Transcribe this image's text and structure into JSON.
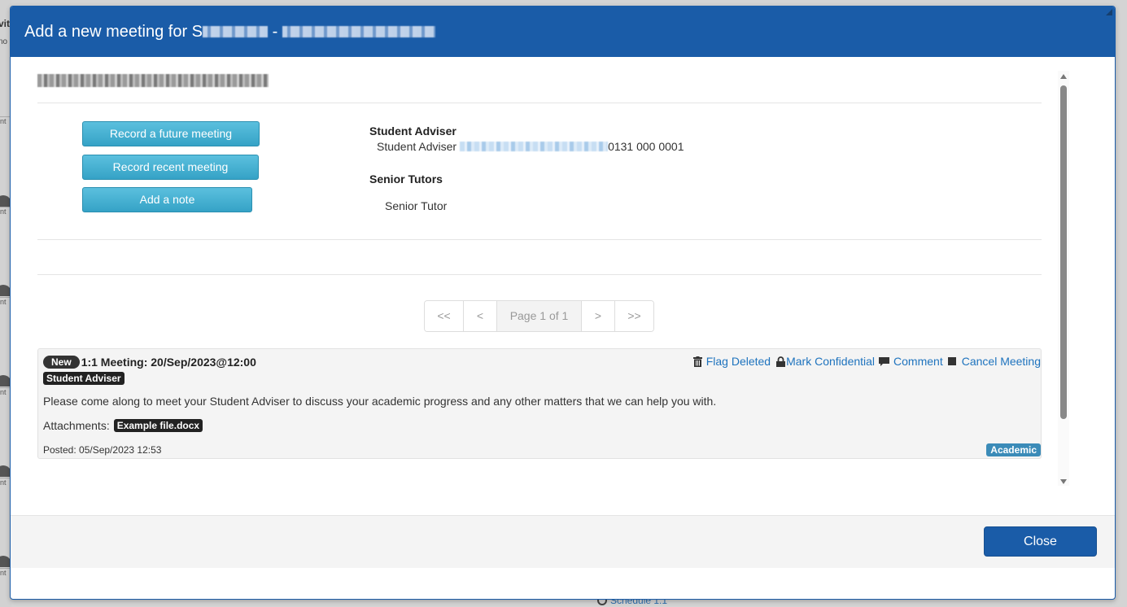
{
  "background": {
    "left_fragments": [
      "vit",
      "no"
    ],
    "row_labels": [
      "nt",
      "nt",
      "nt",
      "nt",
      "nt",
      "nt"
    ],
    "schedule_link": "Schedule 1:1"
  },
  "modal": {
    "title_prefix": "Add a new meeting for S",
    "title_separator": " - ",
    "student_heading_redacted": true,
    "buttons": {
      "record_future": "Record a future meeting",
      "record_recent": "Record recent meeting",
      "add_note": "Add a note"
    },
    "student_adviser": {
      "heading": "Student Adviser",
      "name": "Student Adviser",
      "phone": "0131 000 0001"
    },
    "senior_tutors": {
      "heading": "Senior Tutors",
      "name": "Senior Tutor"
    },
    "pagination": {
      "first": "<<",
      "prev": "<",
      "current": "Page 1 of 1",
      "next": ">",
      "last": ">>"
    },
    "meeting": {
      "badge": "New",
      "title": "1:1 Meeting: 20/Sep/2023@12:00",
      "role_label": "Student Adviser",
      "actions": {
        "flag_deleted": "Flag Deleted",
        "mark_confidential": "Mark Confidential",
        "comment": "Comment",
        "cancel_meeting": "Cancel Meeting"
      },
      "description": "Please come along to meet your Student Adviser to discuss your academic progress and any other matters that we can help you with.",
      "attachments_label": "Attachments:",
      "attachment_file": "Example file.docx",
      "posted": "Posted: 05/Sep/2023 12:53",
      "category": "Academic"
    },
    "footer": {
      "close_label": "Close"
    }
  },
  "colors": {
    "header_blue": "#1a5ca8",
    "info_button": "#5bc0de",
    "link_blue": "#1e73be",
    "academic_badge": "#3b8bb8"
  }
}
